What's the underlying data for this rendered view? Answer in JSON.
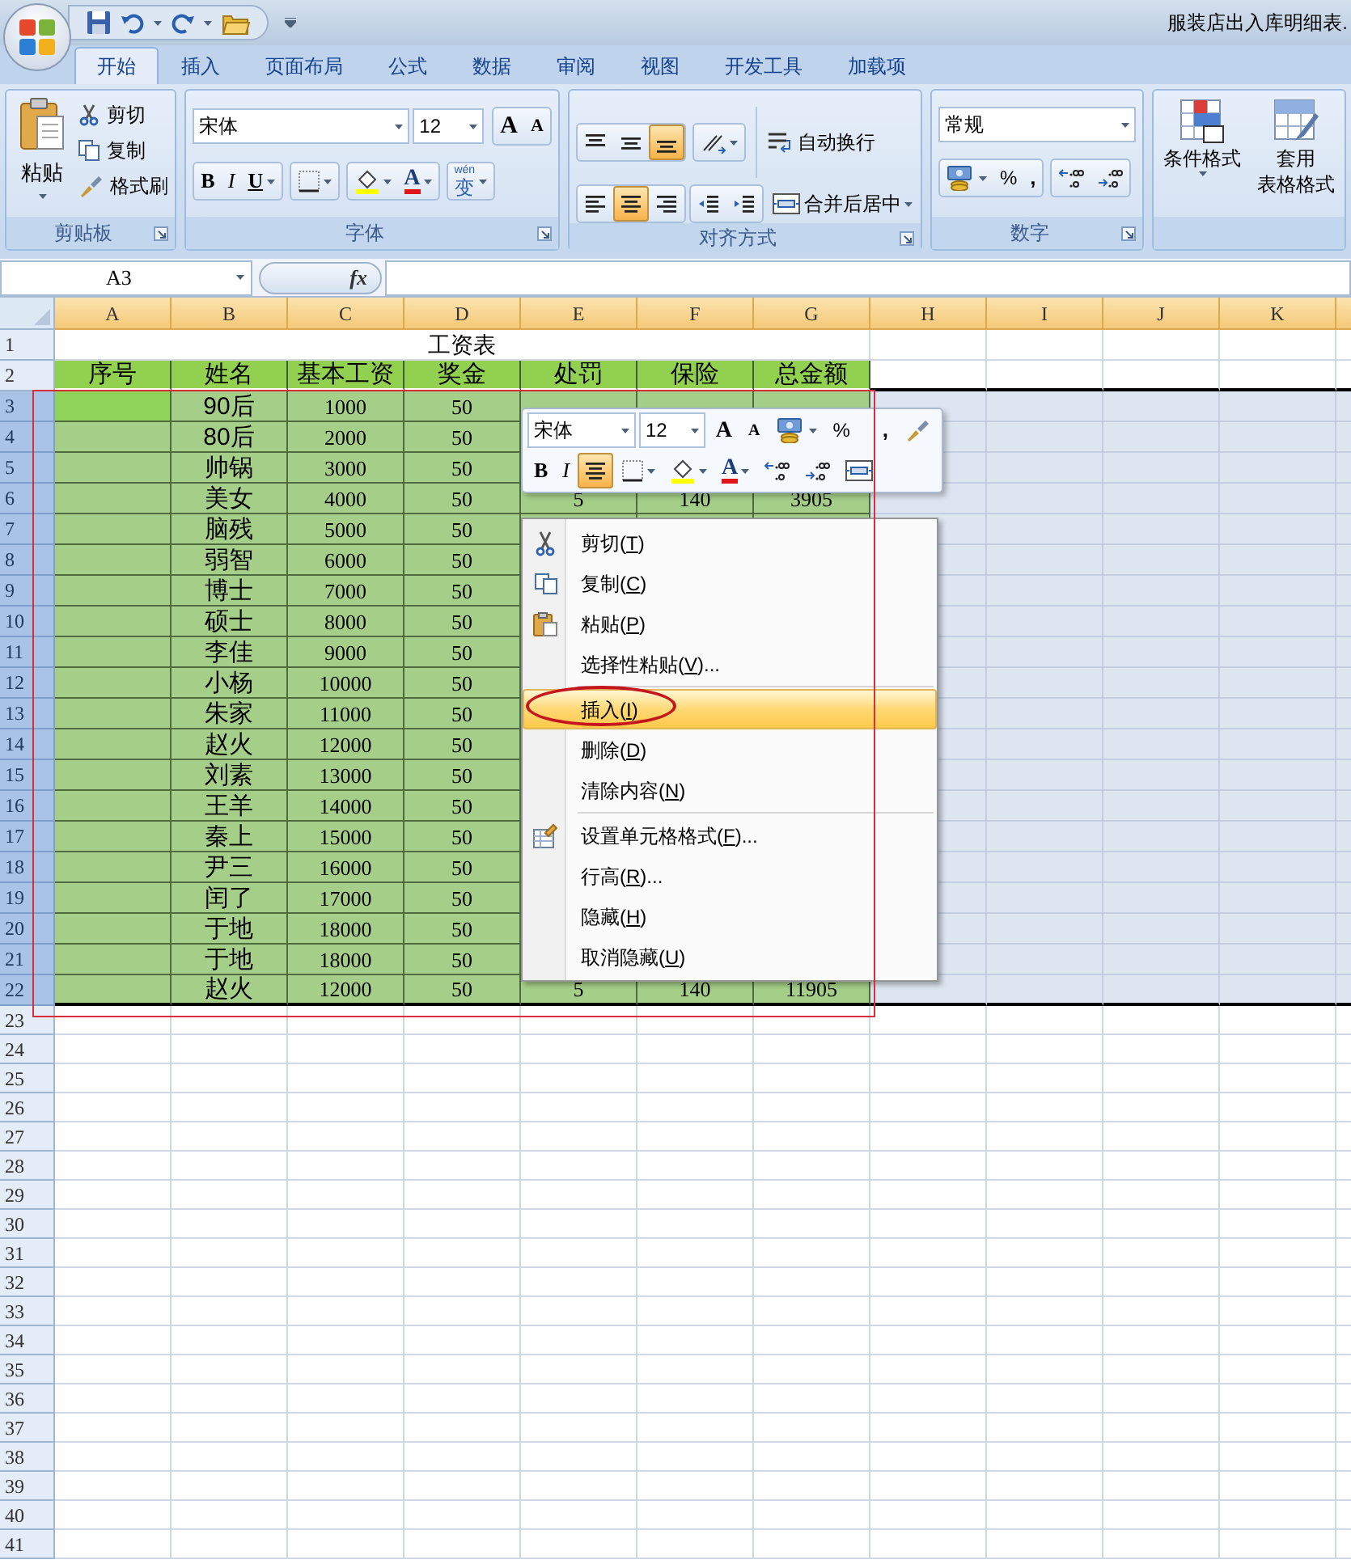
{
  "window": {
    "title": "服装店出入库明细表."
  },
  "tabs": [
    {
      "label": "开始",
      "selected": true
    },
    {
      "label": "插入",
      "selected": false
    },
    {
      "label": "页面布局",
      "selected": false
    },
    {
      "label": "公式",
      "selected": false
    },
    {
      "label": "数据",
      "selected": false
    },
    {
      "label": "审阅",
      "selected": false
    },
    {
      "label": "视图",
      "selected": false
    },
    {
      "label": "开发工具",
      "selected": false
    },
    {
      "label": "加载项",
      "selected": false
    }
  ],
  "ribbon": {
    "groups": [
      {
        "kind": "clipboard",
        "label": "剪贴板",
        "paste": "粘贴",
        "items": [
          "剪切",
          "复制",
          "格式刷"
        ]
      },
      {
        "kind": "font",
        "label": "字体",
        "font": "宋体",
        "size": "12",
        "grow": "A",
        "shrink": "A",
        "bold": "B",
        "italic": "I",
        "underline": "U",
        "font_color": "A",
        "phonetic_pinyin": "wén",
        "phonetic": "变"
      },
      {
        "kind": "alignment",
        "label": "对齐方式",
        "vertical": [
          {
            "selected": false
          },
          {
            "selected": false
          },
          {
            "selected": true
          }
        ],
        "horizontal": [
          {
            "selected": false
          },
          {
            "selected": true
          },
          {
            "selected": false
          }
        ],
        "wrap": "自动换行",
        "merge": "合并后居中"
      },
      {
        "kind": "number",
        "label": "数字",
        "format": "常规",
        "percent": "%",
        "comma": ","
      },
      {
        "kind": "styles",
        "items": [
          {
            "label": "条件格式"
          },
          {
            "label": "套用",
            "label2": "表格格式"
          }
        ]
      }
    ]
  },
  "formula_bar": {
    "name_box": "A3",
    "fx": "fx"
  },
  "sheet": {
    "columns": [
      "A",
      "B",
      "C",
      "D",
      "E",
      "F",
      "G",
      "H",
      "I",
      "J",
      "K"
    ],
    "rows": [
      {
        "kind": "title",
        "number": "1",
        "selected": false,
        "text": "工资表"
      },
      {
        "kind": "header",
        "number": "2",
        "selected": false,
        "cells": [
          "序号",
          "姓名",
          "基本工资",
          "奖金",
          "处罚",
          "保险",
          "总金额"
        ]
      },
      {
        "kind": "data",
        "number": "3",
        "selected": true,
        "active": true,
        "name": "90后",
        "base": "1000",
        "bonus": "50"
      },
      {
        "kind": "data",
        "number": "4",
        "selected": true,
        "active": false,
        "name": "80后",
        "base": "2000",
        "bonus": "50"
      },
      {
        "kind": "data",
        "number": "5",
        "selected": true,
        "active": false,
        "name": "帅锅",
        "base": "3000",
        "bonus": "50"
      },
      {
        "kind": "data",
        "number": "6",
        "selected": true,
        "active": false,
        "name": "美女",
        "base": "4000",
        "bonus": "50",
        "penalty": "5",
        "insurance": "140",
        "total": "3905"
      },
      {
        "kind": "data",
        "number": "7",
        "selected": true,
        "active": false,
        "name": "脑残",
        "base": "5000",
        "bonus": "50"
      },
      {
        "kind": "data",
        "number": "8",
        "selected": true,
        "active": false,
        "name": "弱智",
        "base": "6000",
        "bonus": "50"
      },
      {
        "kind": "data",
        "number": "9",
        "selected": true,
        "active": false,
        "name": "博士",
        "base": "7000",
        "bonus": "50"
      },
      {
        "kind": "data",
        "number": "10",
        "selected": true,
        "active": false,
        "name": "硕士",
        "base": "8000",
        "bonus": "50"
      },
      {
        "kind": "data",
        "number": "11",
        "selected": true,
        "active": false,
        "name": "李佳",
        "base": "9000",
        "bonus": "50"
      },
      {
        "kind": "data",
        "number": "12",
        "selected": true,
        "active": false,
        "name": "小杨",
        "base": "10000",
        "bonus": "50"
      },
      {
        "kind": "data",
        "number": "13",
        "selected": true,
        "active": false,
        "name": "朱家",
        "base": "11000",
        "bonus": "50"
      },
      {
        "kind": "data",
        "number": "14",
        "selected": true,
        "active": false,
        "name": "赵火",
        "base": "12000",
        "bonus": "50"
      },
      {
        "kind": "data",
        "number": "15",
        "selected": true,
        "active": false,
        "name": "刘素",
        "base": "13000",
        "bonus": "50"
      },
      {
        "kind": "data",
        "number": "16",
        "selected": true,
        "active": false,
        "name": "王羊",
        "base": "14000",
        "bonus": "50"
      },
      {
        "kind": "data",
        "number": "17",
        "selected": true,
        "active": false,
        "name": "秦上",
        "base": "15000",
        "bonus": "50"
      },
      {
        "kind": "data",
        "number": "18",
        "selected": true,
        "active": false,
        "name": "尹三",
        "base": "16000",
        "bonus": "50"
      },
      {
        "kind": "data",
        "number": "19",
        "selected": true,
        "active": false,
        "name": "闰了",
        "base": "17000",
        "bonus": "50"
      },
      {
        "kind": "data",
        "number": "20",
        "selected": true,
        "active": false,
        "name": "于地",
        "base": "18000",
        "bonus": "50"
      },
      {
        "kind": "data",
        "number": "21",
        "selected": true,
        "active": false,
        "name": "于地",
        "base": "18000",
        "bonus": "50"
      },
      {
        "kind": "data",
        "number": "22",
        "selected": true,
        "active": false,
        "name": "赵火",
        "base": "12000",
        "bonus": "50",
        "penalty": "5",
        "insurance": "140",
        "total": "11905"
      },
      {
        "kind": "blank",
        "number": "23",
        "selected": false
      },
      {
        "kind": "blank",
        "number": "24",
        "selected": false
      },
      {
        "kind": "blank",
        "number": "25",
        "selected": false
      },
      {
        "kind": "blank",
        "number": "26",
        "selected": false
      },
      {
        "kind": "blank",
        "number": "27",
        "selected": false
      },
      {
        "kind": "blank",
        "number": "28",
        "selected": false
      },
      {
        "kind": "blank",
        "number": "29",
        "selected": false
      },
      {
        "kind": "blank",
        "number": "30",
        "selected": false
      },
      {
        "kind": "blank",
        "number": "31",
        "selected": false
      },
      {
        "kind": "blank",
        "number": "32",
        "selected": false
      },
      {
        "kind": "blank",
        "number": "33",
        "selected": false
      },
      {
        "kind": "blank",
        "number": "34",
        "selected": false
      },
      {
        "kind": "blank",
        "number": "35",
        "selected": false
      },
      {
        "kind": "blank",
        "number": "36",
        "selected": false
      },
      {
        "kind": "blank",
        "number": "37",
        "selected": false
      },
      {
        "kind": "blank",
        "number": "38",
        "selected": false
      },
      {
        "kind": "blank",
        "number": "39",
        "selected": false
      },
      {
        "kind": "blank",
        "number": "40",
        "selected": false
      },
      {
        "kind": "blank",
        "number": "41",
        "selected": false
      }
    ]
  },
  "mini_toolbar": {
    "font": "宋体",
    "size": "12",
    "grow": "A",
    "shrink": "A",
    "percent": "%",
    "comma": ",",
    "bold": "B",
    "italic": "I",
    "center_selected": true,
    "font_color": "A"
  },
  "context_menu": {
    "items": [
      {
        "kind": "cut",
        "before": "剪切(",
        "key": "T",
        "after": ")",
        "selected": false
      },
      {
        "kind": "copy",
        "before": "复制(",
        "key": "C",
        "after": ")",
        "selected": false
      },
      {
        "kind": "paste",
        "before": "粘贴(",
        "key": "P",
        "after": ")",
        "selected": false
      },
      {
        "kind": "item",
        "before": "选择性粘贴(",
        "key": "V",
        "after": ")...",
        "selected": false
      },
      {
        "kind": "separator"
      },
      {
        "kind": "item",
        "before": "插入(",
        "key": "I",
        "after": ")",
        "selected": true
      },
      {
        "kind": "item",
        "before": "删除(",
        "key": "D",
        "after": ")",
        "selected": false
      },
      {
        "kind": "item",
        "before": "清除内容(",
        "key": "N",
        "after": ")",
        "selected": false
      },
      {
        "kind": "separator"
      },
      {
        "kind": "format",
        "before": "设置单元格格式(",
        "key": "F",
        "after": ")...",
        "selected": false
      },
      {
        "kind": "item",
        "before": "行高(",
        "key": "R",
        "after": ")...",
        "selected": false
      },
      {
        "kind": "item",
        "before": "隐藏(",
        "key": "H",
        "after": ")",
        "selected": false
      },
      {
        "kind": "item",
        "before": "取消隐藏(",
        "key": "U",
        "after": ")",
        "selected": false
      }
    ]
  },
  "annotations": {
    "frame": true,
    "circle": true
  }
}
